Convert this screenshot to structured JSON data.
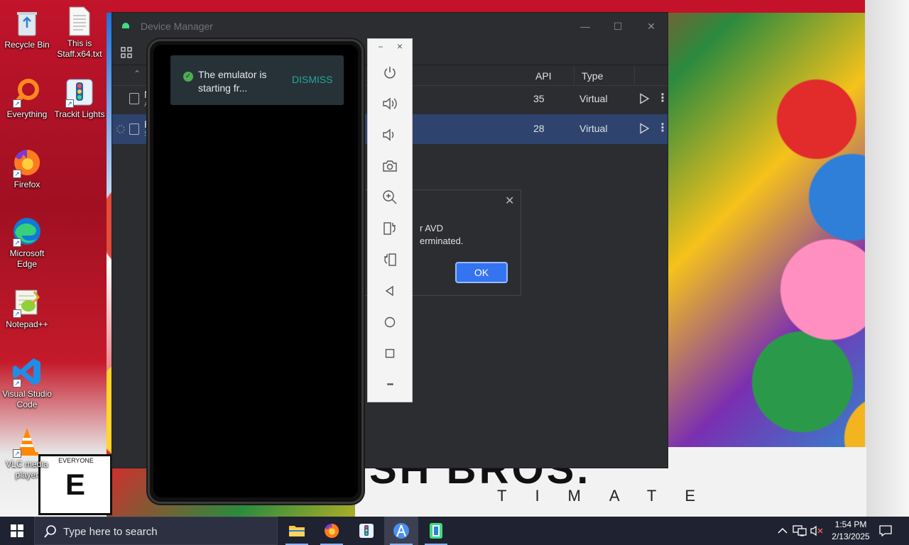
{
  "desktop": {
    "icons": [
      {
        "label": "Recycle Bin"
      },
      {
        "label": "This is Staff.x64.txt"
      },
      {
        "label": "Everything"
      },
      {
        "label": "Trackit Lights"
      },
      {
        "label": "Firefox"
      },
      {
        "label": "Microsoft Edge"
      },
      {
        "label": "Notepad++"
      },
      {
        "label": "Visual Studio Code"
      },
      {
        "label": "VLC media player"
      }
    ],
    "wallpaper": {
      "title": "SH BROS.",
      "subtitle": "TIMATE",
      "rating": "E",
      "rating_banner": "EVERYONE"
    }
  },
  "device_manager": {
    "title": "Device Manager",
    "columns": {
      "api": "API",
      "type": "Type"
    },
    "rows": [
      {
        "name_initial": "N",
        "sub_initial": "A",
        "api": "35",
        "type": "Virtual",
        "selected": false
      },
      {
        "name_initial": "P",
        "sub_initial": "S",
        "api": "28",
        "type": "Virtual",
        "selected": true
      }
    ]
  },
  "error_dialog": {
    "line1": "r AVD",
    "line2": "erminated.",
    "ok_label": "OK"
  },
  "emulator": {
    "snackbar_text": "The emulator is starting fr...",
    "dismiss_label": "DISMISS",
    "toolbar_controls": {
      "minimize": "−",
      "close": "×"
    },
    "more_label": "•••"
  },
  "taskbar": {
    "search_placeholder": "Type here to search",
    "time": "1:54 PM",
    "date": "2/13/2025"
  },
  "colors": {
    "accent": "#3574f0",
    "selected_row": "#2e436e",
    "dismiss": "#26a69a",
    "success": "#4caf50"
  }
}
